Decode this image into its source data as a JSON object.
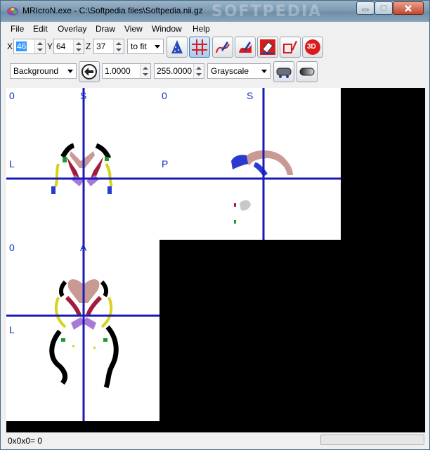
{
  "window": {
    "title": "MRIcroN.exe - C:\\Softpedia files\\Softpedia.nii.gz",
    "watermark": "SOFTPEDIA"
  },
  "menu": [
    "File",
    "Edit",
    "Overlay",
    "Draw",
    "View",
    "Window",
    "Help"
  ],
  "coords": {
    "x_label": "X",
    "x_value": "46",
    "y_label": "Y",
    "y_value": "64",
    "z_label": "Z",
    "z_value": "37",
    "zoom": "to fit"
  },
  "display": {
    "layer": "Background",
    "min": "1.0000",
    "max": "255.0000",
    "colorscheme": "Grayscale"
  },
  "tools": {
    "three_d_label": "3D"
  },
  "views": {
    "coronal": {
      "top_left": "0",
      "top": "S",
      "left": "L"
    },
    "sagittal": {
      "top_left": "0",
      "top": "S",
      "left": "P"
    },
    "axial": {
      "top_left": "0",
      "top": "A",
      "left": "L"
    }
  },
  "status": {
    "text": "0x0x0= 0",
    "progress": 0
  },
  "colors": {
    "crosshair": "#1a1ab8",
    "orientation_label": "#1230c8",
    "selected_text_bg": "#3399ff"
  }
}
